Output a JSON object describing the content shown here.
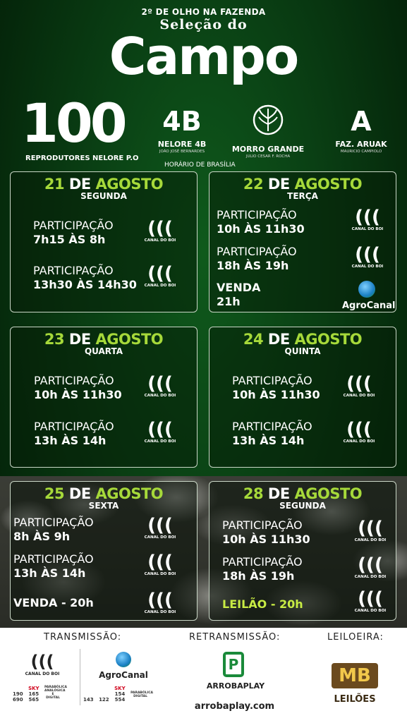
{
  "header": {
    "top_line": "2º DE OLHO NA FAZENDA",
    "selecao": "Seleção do",
    "campo": "Campo",
    "count": "100",
    "count_label": "REPRODUTORES NELORE P.O",
    "timezone": "HORÁRIO DE BRASÍLIA"
  },
  "brands": [
    {
      "logo": "4B",
      "name": "NELORE 4B",
      "owner": "JOÃO JOSÉ BERNARDES"
    },
    {
      "logo": "⌀",
      "name": "MORRO GRANDE",
      "owner": "JULIO CESAR F. ROCHA"
    },
    {
      "logo": "A",
      "name": "FAZ. ARUAK",
      "owner": "MAURICIO CAMPIOLO"
    }
  ],
  "cards": [
    {
      "day": "21",
      "de": "DE",
      "month": "AGOSTO",
      "weekday": "SEGUNDA",
      "entries": [
        {
          "label": "PARTICIPAÇÃO",
          "time": "7h15 ÀS 8h",
          "channel": "CANAL DO BOI"
        },
        {
          "label": "PARTICIPAÇÃO",
          "time": "13h30 ÀS 14h30",
          "channel": "CANAL DO BOI"
        }
      ]
    },
    {
      "day": "22",
      "de": "DE",
      "month": "AGOSTO",
      "weekday": "TERÇA",
      "entries": [
        {
          "label": "PARTICIPAÇÃO",
          "time": "10h ÀS 11h30",
          "channel": "CANAL DO BOI"
        },
        {
          "label": "PARTICIPAÇÃO",
          "time": "18h ÀS 19h",
          "channel": "CANAL DO BOI"
        },
        {
          "label": "VENDA",
          "time": "21h",
          "channel": "AgroCanal"
        }
      ]
    },
    {
      "day": "23",
      "de": "DE",
      "month": "AGOSTO",
      "weekday": "QUARTA",
      "entries": [
        {
          "label": "PARTICIPAÇÃO",
          "time": "10h ÀS 11h30",
          "channel": "CANAL DO BOI"
        },
        {
          "label": "PARTICIPAÇÃO",
          "time": "13h ÀS 14h",
          "channel": "CANAL DO BOI"
        }
      ]
    },
    {
      "day": "24",
      "de": "DE",
      "month": "AGOSTO",
      "weekday": "QUINTA",
      "entries": [
        {
          "label": "PARTICIPAÇÃO",
          "time": "10h ÀS 11h30",
          "channel": "CANAL DO BOI"
        },
        {
          "label": "PARTICIPAÇÃO",
          "time": "13h ÀS 14h",
          "channel": "CANAL DO BOI"
        }
      ]
    },
    {
      "day": "25",
      "de": "DE",
      "month": "AGOSTO",
      "weekday": "SEXTA",
      "entries": [
        {
          "label": "PARTICIPAÇÃO",
          "time": "8h ÀS 9h",
          "channel": "CANAL DO BOI"
        },
        {
          "label": "PARTICIPAÇÃO",
          "time": "13h ÀS 14h",
          "channel": "CANAL DO BOI"
        },
        {
          "label": "",
          "time": "VENDA - 20h",
          "channel": "CANAL DO BOI"
        }
      ]
    },
    {
      "day": "28",
      "de": "DE",
      "month": "AGOSTO",
      "weekday": "SEGUNDA",
      "entries": [
        {
          "label": "PARTICIPAÇÃO",
          "time": "10h ÀS 11h30",
          "channel": "CANAL DO BOI"
        },
        {
          "label": "PARTICIPAÇÃO",
          "time": "18h ÀS 19h",
          "channel": "CANAL DO BOI"
        },
        {
          "label": "",
          "time": "LEILÃO - 20h",
          "channel": "CANAL DO BOI"
        }
      ]
    }
  ],
  "footer": {
    "transmissao": "TRANSMISSÃO:",
    "retransmissao": "RETRANSMISSÃO:",
    "leiloeira": "LEILOEIRA:",
    "canal_do_boi": "CANAL DO BOI",
    "agrocanal": "AgroCanal",
    "canal_numbers": [
      {
        "a": "190",
        "b": "690"
      },
      {
        "a": "165",
        "b": "565"
      }
    ],
    "canal_note": "PARABÓLICA ANALÓGICA E DIGITAL",
    "agro_numbers": [
      "143",
      "122"
    ],
    "agro_sky": {
      "a": "154",
      "b": "554"
    },
    "agro_note": "PARABÓLICA DIGITAL",
    "arrobaplay": "ARROBAPLAY",
    "arrobaplay_url": "arrobaplay.com",
    "mb": "MB",
    "leiloes": "LEILÕES",
    "sky": "SKY"
  }
}
